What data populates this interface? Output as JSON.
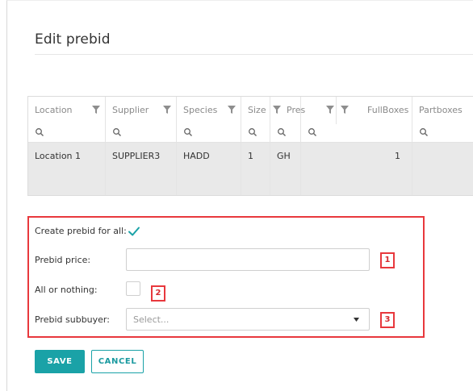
{
  "dialog": {
    "title": "Edit prebid"
  },
  "grid": {
    "columns": [
      {
        "label": "Location"
      },
      {
        "label": "Supplier"
      },
      {
        "label": "Species"
      },
      {
        "label": "Size"
      },
      {
        "label": "Pres"
      },
      {
        "label": "FullBoxes"
      },
      {
        "label": "Partboxes"
      }
    ],
    "row": {
      "location": "Location 1",
      "supplier": "SUPPLIER3",
      "species": "HADD",
      "size": "1",
      "pres": "GH",
      "fullboxes": "1",
      "partboxes": ""
    }
  },
  "form": {
    "create_all_label": "Create prebid for all:",
    "create_all_checked": true,
    "price_label": "Prebid price:",
    "price_value": "",
    "all_or_nothing_label": "All or nothing:",
    "all_or_nothing_checked": false,
    "subbuyer_label": "Prebid subbuyer:",
    "subbuyer_placeholder": "Select..."
  },
  "callouts": {
    "one": "1",
    "two": "2",
    "three": "3"
  },
  "buttons": {
    "save": "SAVE",
    "cancel": "CANCEL"
  },
  "colors": {
    "accent": "#1aa2a7",
    "highlight": "#e8383d",
    "row_bg": "#e9e9e9"
  },
  "icons": {
    "filter": "filter-icon",
    "search": "search-icon",
    "check": "check-icon",
    "dropdown": "chevron-down-icon"
  }
}
